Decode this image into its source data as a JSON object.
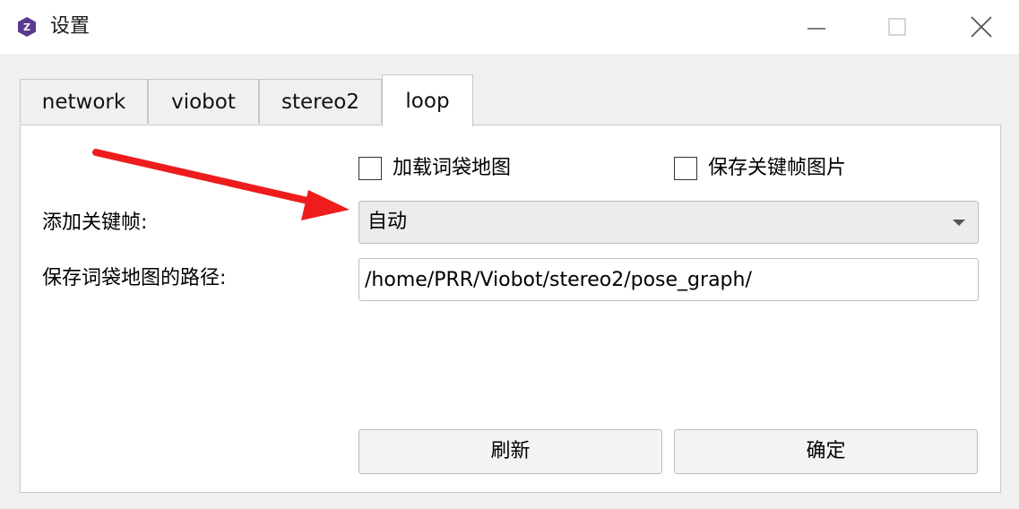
{
  "window": {
    "title": "设置",
    "app_icon": "app-logo-icon",
    "controls": {
      "minimize_icon": "minimize-icon",
      "maximize_icon": "maximize-icon",
      "close_icon": "close-icon"
    }
  },
  "tabs": [
    {
      "label": "network",
      "active": false
    },
    {
      "label": "viobot",
      "active": false
    },
    {
      "label": "stereo2",
      "active": false
    },
    {
      "label": "loop",
      "active": true
    }
  ],
  "loop_panel": {
    "checkboxes": {
      "load_vocab_map": {
        "label": "加载词袋地图",
        "checked": false
      },
      "save_keyframe_images": {
        "label": "保存关键帧图片",
        "checked": false
      }
    },
    "add_keyframe": {
      "label": "添加关键帧:",
      "selected": "自动"
    },
    "vocab_map_path": {
      "label": "保存词袋地图的路径:",
      "value": "/home/PRR/Viobot/stereo2/pose_graph/"
    },
    "buttons": {
      "refresh": "刷新",
      "ok": "确定"
    }
  },
  "colors": {
    "arrow": "#ee1c1c",
    "app_icon_bg": "#5b3a8e"
  }
}
